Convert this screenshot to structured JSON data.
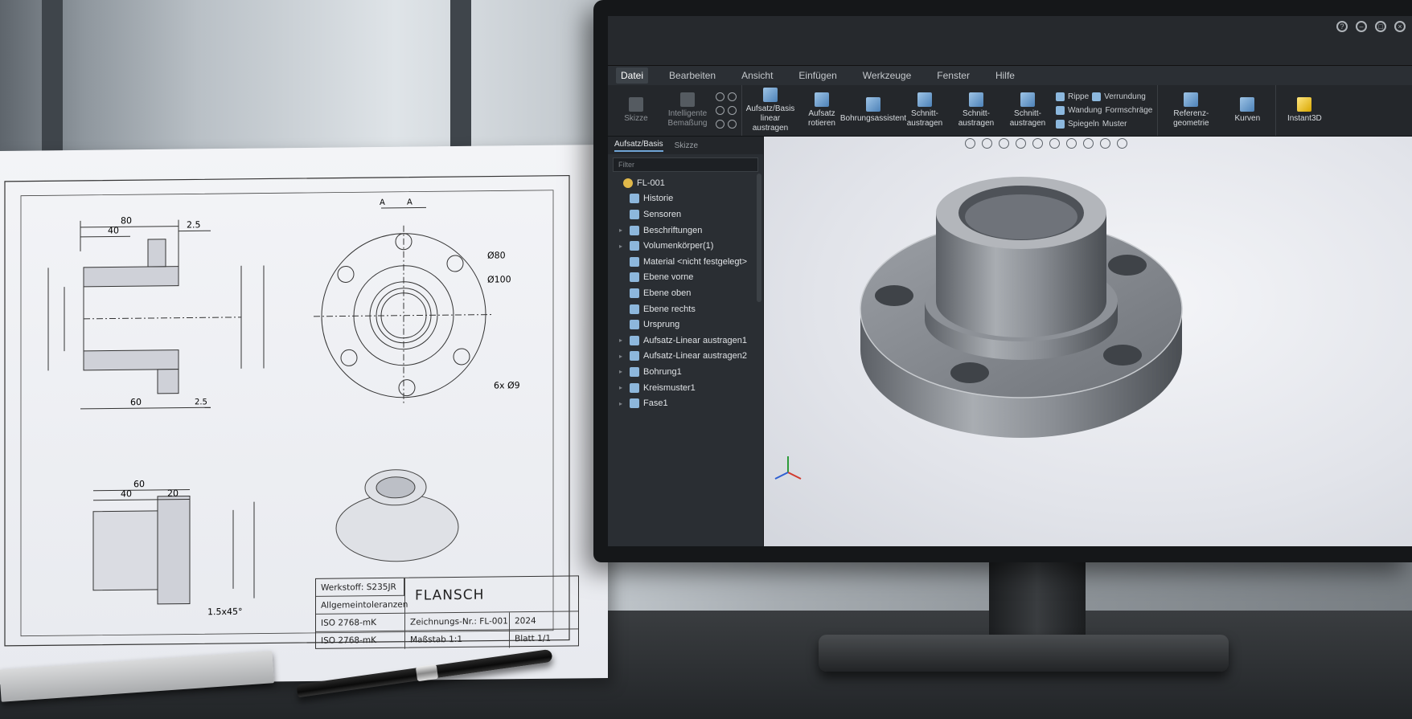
{
  "drawing": {
    "dims_side": [
      "80",
      "40",
      "2.5",
      "60",
      "2.5"
    ],
    "dims_front": [
      "Ø80",
      "Ø100",
      "6x Ø9"
    ],
    "section_marks": [
      "A",
      "A"
    ],
    "dims_section": [
      "60",
      "40",
      "20",
      "1.5x45°"
    ],
    "title_block": {
      "material": "Werkstoff: S235JR",
      "tolerance_label": "Allgemeintoleranzen",
      "tolerance_std_1": "ISO 2768-mK",
      "tolerance_std_2": "ISO 2768-mK",
      "title": "FLANSCH",
      "drawing_no": "Zeichnungs-Nr.: FL-001",
      "scale": "Maßstab 1:1",
      "date": "2024",
      "sheet": "Blatt   1/1"
    }
  },
  "app": {
    "menu": [
      "Datei",
      "Bearbeiten",
      "Ansicht",
      "Einfügen",
      "Werkzeuge",
      "Fenster",
      "Hilfe"
    ],
    "ribbon": {
      "sketch": "Skizze",
      "smart_dim": "Intelligente Bemaßung",
      "boss_extrude": "Aufsatz/Basis linear austragen",
      "boss_revolve": "Aufsatz rotieren",
      "hole": "Bohrungsassistent",
      "cut_extrude": "Schnitt-austragen",
      "cut_revolve": "Schnitt-austragen",
      "cut_sweep": "Schnitt-austragen",
      "rib": "Rippe",
      "draft": "Formschräge",
      "mirror": "Spiegeln",
      "fillet": "Verrundung",
      "shell": "Wandung",
      "pattern": "Muster",
      "ref_geom": "Referenz-geometrie",
      "curves": "Kurven",
      "instant3d": "Instant3D"
    },
    "panel": {
      "tabs": [
        "Aufsatz/Basis",
        "Skizze"
      ],
      "filter_placeholder": "Filter",
      "tree": [
        {
          "label": "FL-001",
          "root": true
        },
        {
          "label": "Historie"
        },
        {
          "label": "Sensoren"
        },
        {
          "label": "Beschriftungen",
          "arrow": true
        },
        {
          "label": "Volumenkörper(1)",
          "arrow": true
        },
        {
          "label": "Material <nicht festgelegt>"
        },
        {
          "label": "Ebene vorne"
        },
        {
          "label": "Ebene oben"
        },
        {
          "label": "Ebene rechts"
        },
        {
          "label": "Ursprung"
        },
        {
          "label": "Aufsatz-Linear austragen1",
          "arrow": true
        },
        {
          "label": "Aufsatz-Linear austragen2",
          "arrow": true
        },
        {
          "label": "Bohrung1",
          "arrow": true
        },
        {
          "label": "Kreismuster1",
          "arrow": true
        },
        {
          "label": "Fase1",
          "arrow": true
        }
      ]
    }
  }
}
